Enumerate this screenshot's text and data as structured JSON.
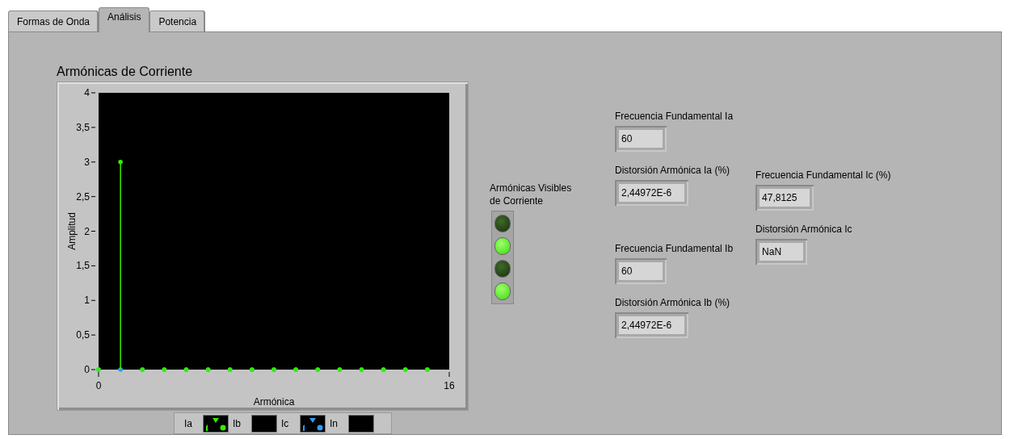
{
  "tabs": [
    {
      "label": "Formas de Onda",
      "selected": false
    },
    {
      "label": "Análisis",
      "selected": true
    },
    {
      "label": "Potencia",
      "selected": false
    }
  ],
  "graph": {
    "title": "Armónicas de Corriente",
    "chart_data": {
      "type": "bar",
      "xlabel": "Armónica",
      "ylabel": "Amplitud",
      "x": [
        0,
        1,
        2,
        3,
        4,
        5,
        6,
        7,
        8,
        9,
        10,
        11,
        12,
        13,
        14,
        15
      ],
      "xlim": [
        0,
        16
      ],
      "ylim": [
        0,
        4
      ],
      "xticks": [
        0,
        16
      ],
      "yticks": [
        {
          "value": 0,
          "label": "0"
        },
        {
          "value": 0.5,
          "label": "0,5"
        },
        {
          "value": 1,
          "label": "1"
        },
        {
          "value": 1.5,
          "label": "1,5"
        },
        {
          "value": 2,
          "label": "2"
        },
        {
          "value": 2.5,
          "label": "2,5"
        },
        {
          "value": 3,
          "label": "3"
        },
        {
          "value": 3.5,
          "label": "3,5"
        },
        {
          "value": 4,
          "label": "4"
        }
      ],
      "series": [
        {
          "name": "Ia",
          "color": "#33ee00",
          "values": [
            0,
            3,
            0,
            0,
            0,
            0,
            0,
            0,
            0,
            0,
            0,
            0,
            0,
            0,
            0,
            0
          ]
        },
        {
          "name": "Ib",
          "values": [
            null,
            null,
            null,
            null,
            null,
            null,
            null,
            null,
            null,
            null,
            null,
            null,
            null,
            null,
            null,
            null
          ]
        },
        {
          "name": "Ic",
          "color": "#3399ff",
          "values": [
            0,
            0,
            0,
            0,
            0,
            0,
            0,
            0,
            0,
            0,
            0,
            0,
            0,
            0,
            0,
            0
          ]
        },
        {
          "name": "In",
          "values": [
            null,
            null,
            null,
            null,
            null,
            null,
            null,
            null,
            null,
            null,
            null,
            null,
            null,
            null,
            null,
            null
          ]
        }
      ]
    }
  },
  "leds": {
    "label": "Armónicas Visibles de Corriente",
    "items": [
      {
        "on": false
      },
      {
        "on": true
      },
      {
        "on": false
      },
      {
        "on": true
      }
    ]
  },
  "indicator_columns": [
    {
      "groups": [
        [
          {
            "label": "Frecuencia Fundamental Ia",
            "value": "60"
          },
          {
            "label": "Distorsión Armónica Ia (%)",
            "value": "2,44972E-6"
          }
        ],
        [
          {
            "label": "Frecuencia Fundamental Ib",
            "value": "60"
          },
          {
            "label": "Distorsión Armónica Ib (%)",
            "value": "2,44972E-6"
          }
        ]
      ]
    },
    {
      "groups": [
        [
          {
            "label": "Frecuencia Fundamental Ic (%)",
            "value": "47,8125"
          },
          {
            "label": "Distorsión Armónica Ic",
            "value": "NaN"
          }
        ]
      ]
    }
  ]
}
